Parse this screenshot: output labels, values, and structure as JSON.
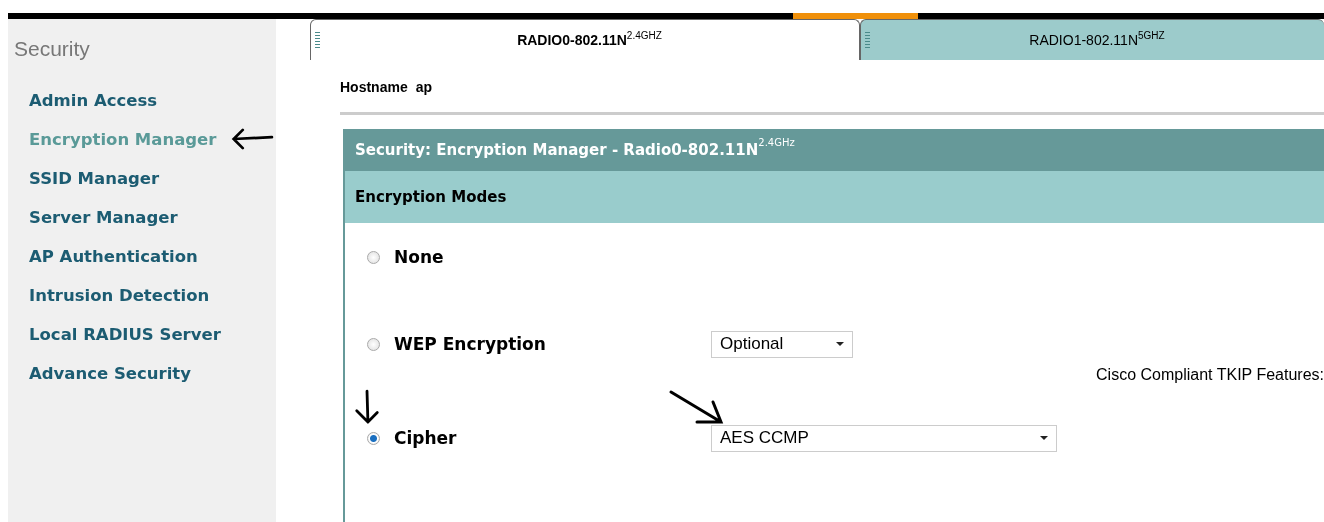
{
  "sidebar": {
    "title": "Security",
    "items": [
      {
        "label": "Admin Access",
        "selected": false
      },
      {
        "label": "Encryption Manager",
        "selected": true
      },
      {
        "label": "SSID Manager",
        "selected": false
      },
      {
        "label": "Server Manager",
        "selected": false
      },
      {
        "label": "AP Authentication",
        "selected": false
      },
      {
        "label": "Intrusion Detection",
        "selected": false
      },
      {
        "label": "Local RADIUS Server",
        "selected": false
      },
      {
        "label": "Advance Security",
        "selected": false
      }
    ]
  },
  "tabs": [
    {
      "label": "RADIO0-802.11N$^{2.4GHZ}$",
      "selected": true
    },
    {
      "label": "RADIO1-802.11N$^{5GHZ}$",
      "selected": false
    }
  ],
  "hostname": {
    "label": "Hostname",
    "value": "ap"
  },
  "panel": {
    "title": "Security: Encryption Manager - Radio0-802.11N$^{2.4GHz}$",
    "section": "Encryption Modes",
    "modes": [
      {
        "label": "None",
        "selected": false
      },
      {
        "label": "WEP Encryption",
        "selected": false,
        "dropdown": "Optional",
        "note": "Cisco Compliant TKIP Features:"
      },
      {
        "label": "Cipher",
        "selected": true,
        "dropdown": "AES CCMP"
      }
    ]
  }
}
